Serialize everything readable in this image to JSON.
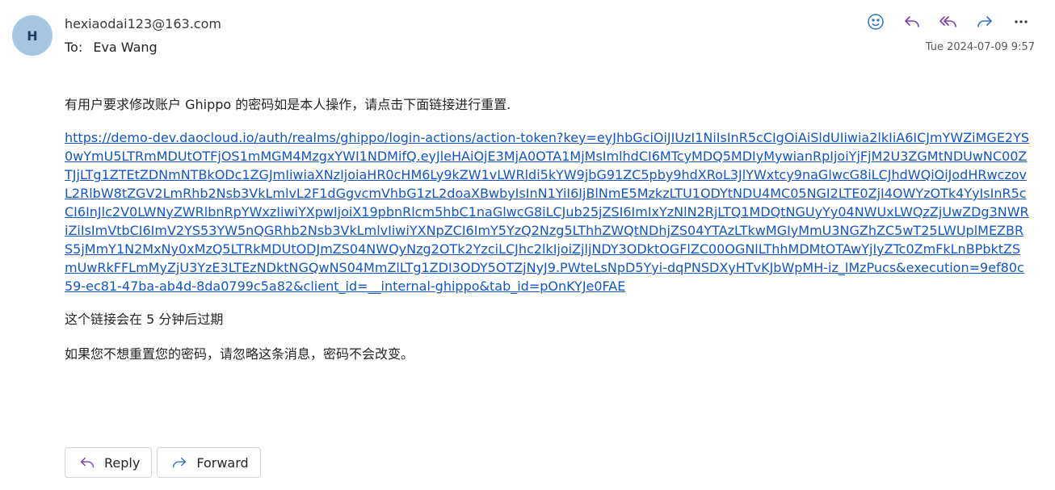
{
  "header": {
    "avatar_initial": "H",
    "sender": "hexiaodai123@163.com",
    "to_label": "To:",
    "to_name": "Eva Wang",
    "timestamp": "Tue 2024-07-09 9:57"
  },
  "toolbar": {
    "icons": [
      "smiley-icon",
      "reply-icon",
      "reply-all-icon",
      "forward-icon",
      "more-icon"
    ],
    "accent": "#5b3aa8"
  },
  "message": {
    "intro": "有用户要求修改账户 Ghippo 的密码如是本人操作，请点击下面链接进行重置.",
    "link": "https://demo-dev.daocloud.io/auth/realms/ghippo/login-actions/action-token?key=eyJhbGciOiJIUzI1NiIsInR5cCIgOiAiSldUIiwia2lkIiA6ICJmYWZiMGE2YS0wYmU5LTRmMDUtOTFjOS1mMGM4MzgxYWI1NDMifQ.eyJleHAiOjE3MjA0OTA1MjMsImlhdCI6MTcyMDQ5MDIyMywianRpIjoiYjFjM2U3ZGMtNDUwNC00ZTJjLTg1ZTEtZDNmNTBkODc1ZGJmIiwiaXNzIjoiaHR0cHM6Ly9kZW1vLWRldi5kYW9jbG91ZC5pby9hdXRoL3JlYWxtcy9naGlwcG8iLCJhdWQiOiJodHRwczovL2RlbW8tZGV2LmRhb2Nsb3VkLmlvL2F1dGgvcmVhbG1zL2doaXBwbyIsInN1YiI6IjBlNmE5MzkzLTU1ODYtNDU4MC05NGI2LTE0ZjI4OWYzOTk4YyIsInR5cCI6InJlc2V0LWNyZWRlbnRpYWxzIiwiYXpwIjoiX19pbnRlcm5hbC1naGlwcG8iLCJub25jZSI6ImIxYzNlN2RjLTQ1MDQtNGUyYy04NWUxLWQzZjUwZDg3NWRiZiIsImVtbCI6ImV2YS53YW5nQGRhb2Nsb3VkLmlvIiwiYXNpZCI6ImY5YzQ2Nzg5LThhZWQtNDhjZS04YTAzLTkwMGIyMmU3NGZhZC5wT25LWUplMEZBRS5jMmY1N2MxNy0xMzQ5LTRkMDUtODJmZS04NWQyNzg2OTk2YzciLCJhc2lkIjoiZjljNDY3ODktOGFlZC00OGNlLThhMDMtOTAwYjIyZTc0ZmFkLnBPbktZSmUwRkFFLmMyZjU3YzE3LTEzNDktNGQwNS04MmZlLTg1ZDI3ODY5OTZjNyJ9.PWteLsNpD5Yyi-dqPNSDXyHTvKJbWpMH-iz_lMzPucs&execution=9ef80c59-ec81-47ba-ab4d-8da0799c5a82&client_id=__internal-ghippo&tab_id=pOnKYJe0FAE",
    "expire_note": "这个链接会在 5 分钟后过期",
    "ignore_note": "如果您不想重置您的密码，请忽略这条消息，密码不会改变。"
  },
  "footer": {
    "reply_label": "Reply",
    "forward_label": "Forward"
  }
}
